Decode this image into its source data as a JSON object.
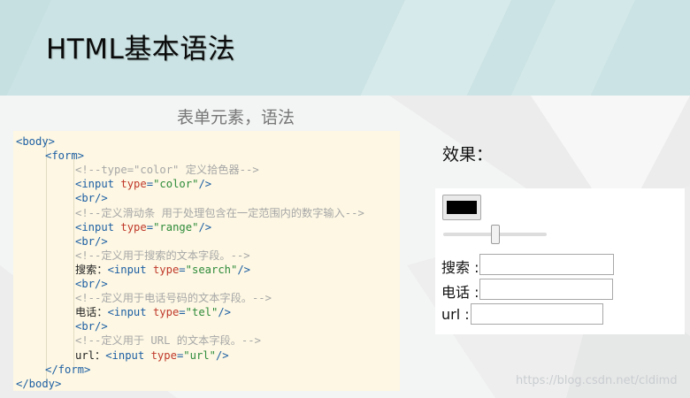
{
  "slide": {
    "title": "HTML基本语法",
    "subtitle": "表单元素，语法"
  },
  "code_lines": [
    {
      "indent": 0,
      "tokens": [
        {
          "t": "tag",
          "v": "<body>"
        }
      ]
    },
    {
      "indent": 1,
      "tokens": [
        {
          "t": "tag",
          "v": "<form>"
        }
      ]
    },
    {
      "indent": 2,
      "tokens": [
        {
          "t": "com",
          "v": "<!--type=\"color\" 定义拾色器-->"
        }
      ]
    },
    {
      "indent": 2,
      "tokens": [
        {
          "t": "tag",
          "v": "<input "
        },
        {
          "t": "attr",
          "v": "type"
        },
        {
          "t": "tag",
          "v": "="
        },
        {
          "t": "str",
          "v": "\"color\""
        },
        {
          "t": "tag",
          "v": "/>"
        }
      ]
    },
    {
      "indent": 2,
      "tokens": [
        {
          "t": "tag",
          "v": "<br/>"
        }
      ]
    },
    {
      "indent": 2,
      "tokens": [
        {
          "t": "com",
          "v": "<!--定义滑动条 用于处理包含在一定范围内的数字输入-->"
        }
      ]
    },
    {
      "indent": 2,
      "tokens": [
        {
          "t": "tag",
          "v": "<input "
        },
        {
          "t": "attr",
          "v": "type"
        },
        {
          "t": "tag",
          "v": "="
        },
        {
          "t": "str",
          "v": "\"range\""
        },
        {
          "t": "tag",
          "v": "/>"
        }
      ]
    },
    {
      "indent": 2,
      "tokens": [
        {
          "t": "tag",
          "v": "<br/>"
        }
      ]
    },
    {
      "indent": 2,
      "tokens": [
        {
          "t": "com",
          "v": "<!--定义用于搜索的文本字段。-->"
        }
      ]
    },
    {
      "indent": 2,
      "tokens": [
        {
          "t": "txt",
          "v": "搜索："
        },
        {
          "t": "tag",
          "v": "<input "
        },
        {
          "t": "attr",
          "v": "type"
        },
        {
          "t": "tag",
          "v": "="
        },
        {
          "t": "str",
          "v": "\"search\""
        },
        {
          "t": "tag",
          "v": "/>"
        }
      ]
    },
    {
      "indent": 2,
      "tokens": [
        {
          "t": "tag",
          "v": "<br/>"
        }
      ]
    },
    {
      "indent": 2,
      "tokens": [
        {
          "t": "com",
          "v": "<!--定义用于电话号码的文本字段。-->"
        }
      ]
    },
    {
      "indent": 2,
      "tokens": [
        {
          "t": "txt",
          "v": "电话："
        },
        {
          "t": "tag",
          "v": "<input "
        },
        {
          "t": "attr",
          "v": "type"
        },
        {
          "t": "tag",
          "v": "="
        },
        {
          "t": "str",
          "v": "\"tel\""
        },
        {
          "t": "tag",
          "v": "/>"
        }
      ]
    },
    {
      "indent": 2,
      "tokens": [
        {
          "t": "tag",
          "v": "<br/>"
        }
      ]
    },
    {
      "indent": 2,
      "tokens": [
        {
          "t": "com",
          "v": "<!--定义用于 URL 的文本字段。-->"
        }
      ]
    },
    {
      "indent": 2,
      "tokens": [
        {
          "t": "txt",
          "v": "url："
        },
        {
          "t": "tag",
          "v": "<input "
        },
        {
          "t": "attr",
          "v": "type"
        },
        {
          "t": "tag",
          "v": "="
        },
        {
          "t": "str",
          "v": "\"url\""
        },
        {
          "t": "tag",
          "v": "/>"
        }
      ]
    },
    {
      "indent": 1,
      "tokens": [
        {
          "t": "tag",
          "v": "</form>"
        }
      ]
    },
    {
      "indent": 0,
      "tokens": [
        {
          "t": "tag",
          "v": "</body>"
        }
      ]
    }
  ],
  "effect": {
    "label": "效果：",
    "color_value": "#000000",
    "range_value": 50,
    "search_label": "搜索 :",
    "tel_label": "电话 :",
    "url_label": "url :",
    "search_value": "",
    "tel_value": "",
    "url_value": ""
  },
  "watermark": "https://blog.csdn.net/cldimd",
  "colors": {
    "header": "#cbe3e4",
    "code_bg": "#fdf7e3",
    "tag": "#1d5fa3",
    "attr": "#c0392b",
    "string": "#2e8b3a",
    "comment": "#a7a7a7"
  }
}
